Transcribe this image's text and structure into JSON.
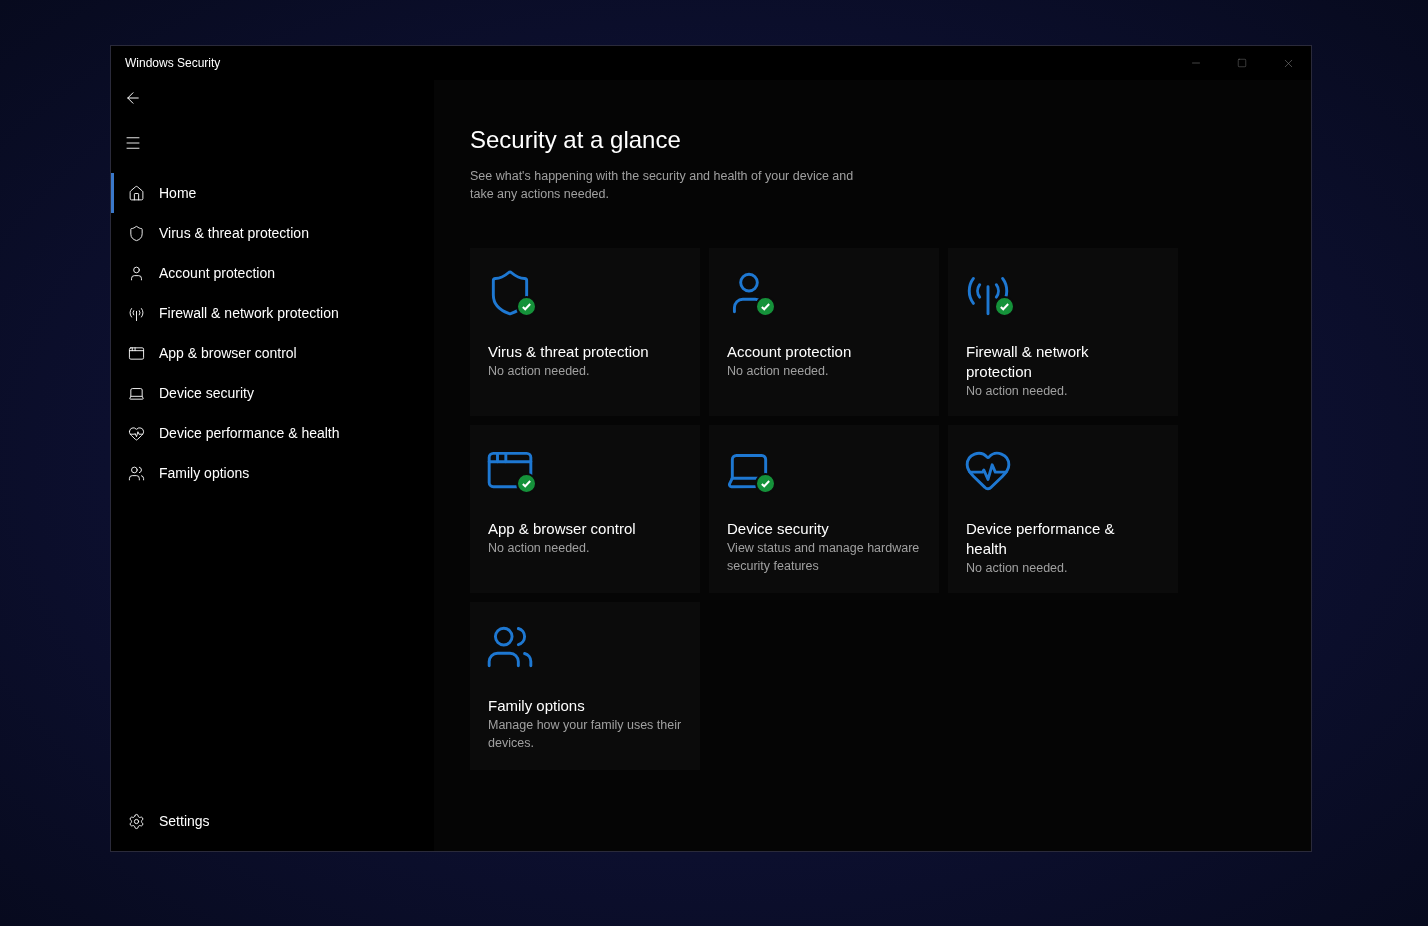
{
  "window": {
    "title": "Windows Security"
  },
  "sidebar": {
    "items": [
      {
        "kind": "home",
        "label": "Home",
        "selected": true
      },
      {
        "kind": "shield",
        "label": "Virus & threat protection",
        "selected": false
      },
      {
        "kind": "account",
        "label": "Account protection",
        "selected": false
      },
      {
        "kind": "network",
        "label": "Firewall & network protection",
        "selected": false
      },
      {
        "kind": "browser",
        "label": "App & browser control",
        "selected": false
      },
      {
        "kind": "device",
        "label": "Device security",
        "selected": false
      },
      {
        "kind": "health",
        "label": "Device performance & health",
        "selected": false
      },
      {
        "kind": "family",
        "label": "Family options",
        "selected": false
      }
    ],
    "settings": "Settings"
  },
  "main": {
    "title": "Security at a glance",
    "subtitle": "See what's happening with the security and health of your device and take any actions needed.",
    "cards": [
      {
        "kind": "shield",
        "title": "Virus & threat protection",
        "status": "No action needed.",
        "checked": true
      },
      {
        "kind": "account",
        "title": "Account protection",
        "status": "No action needed.",
        "checked": true
      },
      {
        "kind": "network",
        "title": "Firewall & network protection",
        "status": "No action needed.",
        "checked": true
      },
      {
        "kind": "browser",
        "title": "App & browser control",
        "status": "No action needed.",
        "checked": true
      },
      {
        "kind": "device",
        "title": "Device security",
        "status": "View status and manage hardware security features",
        "checked": true
      },
      {
        "kind": "health",
        "title": "Device performance & health",
        "status": "No action needed.",
        "checked": false
      },
      {
        "kind": "family",
        "title": "Family options",
        "status": "Manage how your family uses their devices.",
        "checked": false
      }
    ]
  }
}
